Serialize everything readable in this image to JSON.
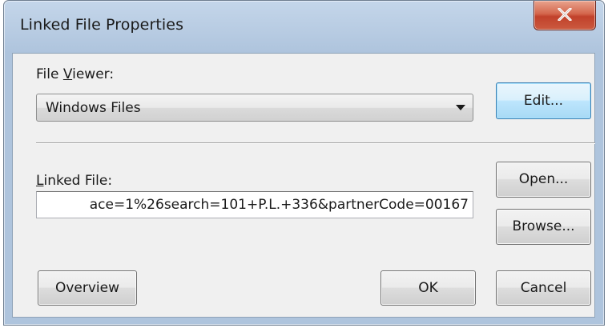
{
  "dialog": {
    "title": "Linked File Properties",
    "close_label": "X"
  },
  "file_viewer": {
    "label_mnemonic": "V",
    "label_prefix": "File ",
    "label_suffix": "iewer:",
    "selected_value": "Windows Files"
  },
  "linked_file": {
    "label_mnemonic": "L",
    "label_suffix": "inked File:",
    "value": "ace=1%26search=101+P.L.+336&partnerCode=00167"
  },
  "buttons": {
    "edit": "Edit...",
    "open": "Open...",
    "browse": "Browse...",
    "overview": "Overview",
    "ok": "OK",
    "cancel": "Cancel"
  },
  "colors": {
    "frame": "#b7cbe2",
    "client": "#f0f0f0",
    "close_button": "#c1412b",
    "default_button_border": "#3c7fb1"
  },
  "icons": {
    "close": "close-x-icon",
    "dropdown": "chevron-down-icon"
  }
}
